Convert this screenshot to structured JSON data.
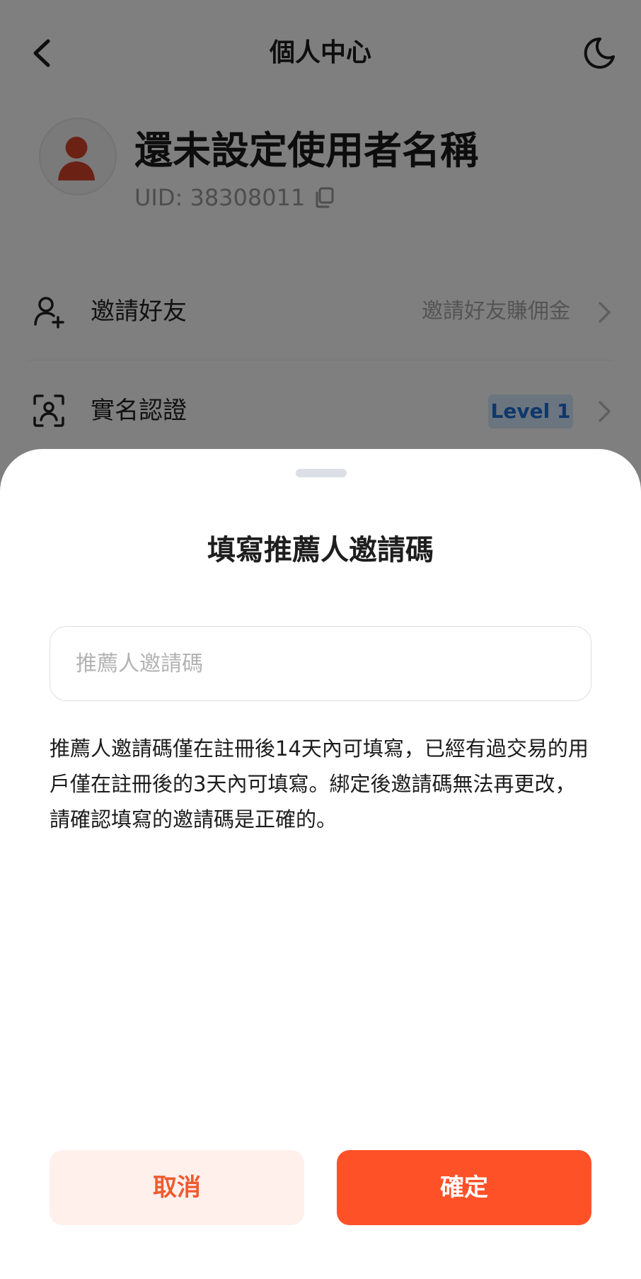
{
  "header": {
    "title": "個人中心",
    "back_icon": "chevron-left-icon",
    "theme_icon": "moon-icon"
  },
  "profile": {
    "username": "還未設定使用者名稱",
    "uid": "UID: 38308011",
    "avatar_icon": "user-silhouette-icon",
    "copy_icon": "copy-icon"
  },
  "menu": {
    "items": [
      {
        "icon": "add-user-icon",
        "label": "邀請好友",
        "sub": "邀請好友賺佣金"
      },
      {
        "icon": "face-scan-icon",
        "label": "實名認證",
        "badge": "Level 1"
      }
    ]
  },
  "sheet": {
    "title": "填寫推薦人邀請碼",
    "input": {
      "value": "",
      "placeholder": "推薦人邀請碼"
    },
    "notice": "推薦人邀請碼僅在註冊後14天內可填寫，已經有過交易的用戶僅在註冊後的3天內可填寫。綁定後邀請碼無法再更改，請確認填寫的邀請碼是正確的。",
    "cancel_label": "取消",
    "confirm_label": "確定"
  },
  "colors": {
    "accent": "#ff5128",
    "cancel_bg": "#fff0ec",
    "badge_bg": "#d7eaff",
    "badge_text": "#1e6fd6",
    "overlay": "rgba(0,0,0,0.5)"
  }
}
